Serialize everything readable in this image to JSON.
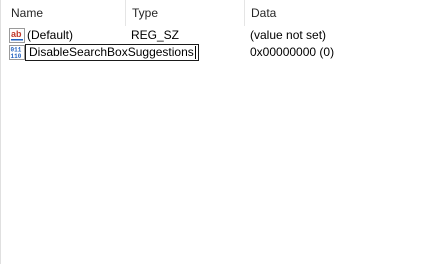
{
  "columns": {
    "name": "Name",
    "type": "Type",
    "data": "Data"
  },
  "rows": [
    {
      "icon": "string-value-icon",
      "name": "(Default)",
      "type": "REG_SZ",
      "data": "(value not set)"
    },
    {
      "icon": "dword-value-icon",
      "name": "DisableSearchBoxSuggestions",
      "type": "",
      "data": "0x00000000 (0)",
      "editing": true
    }
  ],
  "colors": {
    "string_icon_red": "#c0392b",
    "dword_icon_blue": "#1f5fbf"
  }
}
